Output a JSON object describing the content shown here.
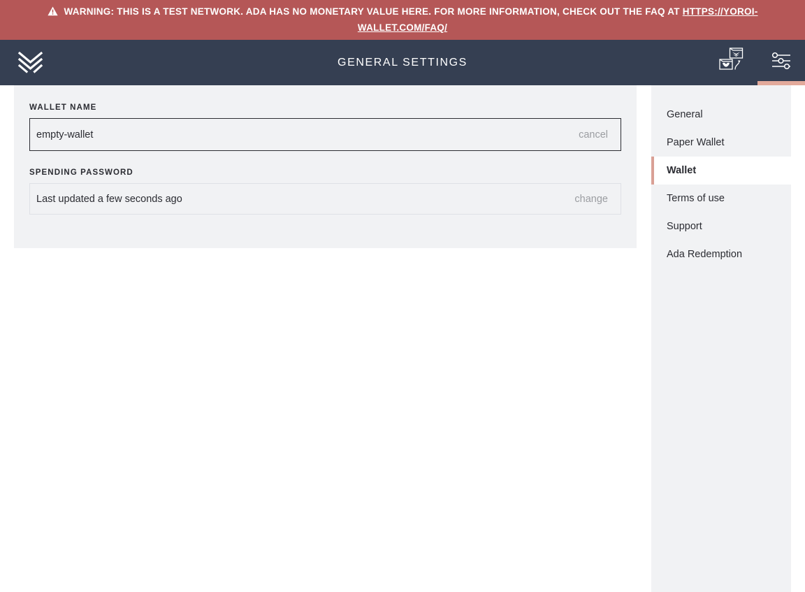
{
  "warning": {
    "icon": "warning-triangle-icon",
    "text": "WARNING: THIS IS A TEST NETWORK. ADA HAS NO MONETARY VALUE HERE. FOR MORE INFORMATION, CHECK OUT THE FAQ AT ",
    "link_text": "HTTPS://YOROI-WALLET.COM/FAQ/",
    "background_color": "#b55757",
    "text_color": "#ffffff"
  },
  "topbar": {
    "logo_name": "yoroi-logo",
    "title": "GENERAL SETTINGS",
    "background_color": "#353f52",
    "actions": [
      {
        "name": "wallet-switch-icon",
        "label": "Switch wallet",
        "active": false
      },
      {
        "name": "settings-sliders-icon",
        "label": "Settings",
        "active": true
      }
    ],
    "active_indicator_color": "#e3aa9b"
  },
  "main": {
    "wallet_name": {
      "label": "WALLET NAME",
      "value": "empty-wallet",
      "placeholder": "Wallet name",
      "action_label": "cancel"
    },
    "spending_password": {
      "label": "SPENDING PASSWORD",
      "status": "Last updated a few seconds ago",
      "action_label": "change"
    },
    "panel_background": "#f1f2f4"
  },
  "settings_menu": {
    "active_accent_color": "#d9a095",
    "items": [
      {
        "label": "General",
        "active": false
      },
      {
        "label": "Paper Wallet",
        "active": false
      },
      {
        "label": "Wallet",
        "active": true
      },
      {
        "label": "Terms of use",
        "active": false
      },
      {
        "label": "Support",
        "active": false
      },
      {
        "label": "Ada Redemption",
        "active": false
      }
    ]
  }
}
